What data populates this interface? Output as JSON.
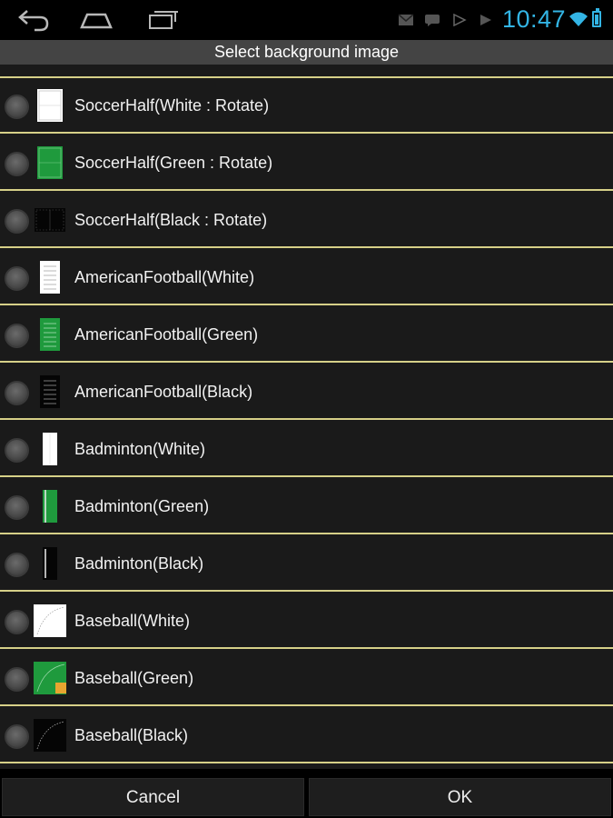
{
  "status_bar": {
    "time": "10:47",
    "accent": "#33b5e5",
    "icons": [
      "back-icon",
      "home-icon",
      "recent-apps-icon",
      "gmail-icon",
      "chat-icon",
      "play-store-icon",
      "play-store-icon",
      "wifi-icon",
      "battery-icon"
    ]
  },
  "dialog": {
    "title": "Select background image",
    "separator_color": "#d6d088",
    "items": [
      {
        "label": "SoccerHalf(White : Rotate)",
        "thumb": "soccer-white"
      },
      {
        "label": "SoccerHalf(Green : Rotate)",
        "thumb": "soccer-green"
      },
      {
        "label": "SoccerHalf(Black : Rotate)",
        "thumb": "soccer-black"
      },
      {
        "label": "AmericanFootball(White)",
        "thumb": "football-white"
      },
      {
        "label": "AmericanFootball(Green)",
        "thumb": "football-green"
      },
      {
        "label": "AmericanFootball(Black)",
        "thumb": "football-black"
      },
      {
        "label": "Badminton(White)",
        "thumb": "badminton-white"
      },
      {
        "label": "Badminton(Green)",
        "thumb": "badminton-green"
      },
      {
        "label": "Badminton(Black)",
        "thumb": "badminton-black"
      },
      {
        "label": "Baseball(White)",
        "thumb": "baseball-white"
      },
      {
        "label": "Baseball(Green)",
        "thumb": "baseball-green"
      },
      {
        "label": "Baseball(Black)",
        "thumb": "baseball-black"
      }
    ],
    "cancel_label": "Cancel",
    "ok_label": "OK"
  }
}
